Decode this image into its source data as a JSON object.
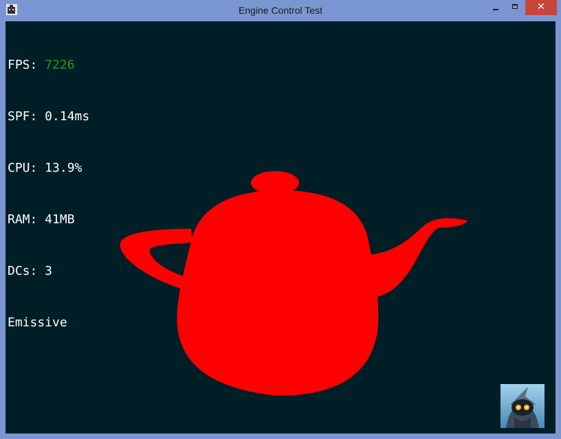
{
  "window": {
    "title": "Engine Control Test",
    "icon": "teapot-app-icon",
    "controls": {
      "minimize_icon": "minimize-icon",
      "maximize_icon": "maximize-icon",
      "close_icon": "close-icon",
      "close_glyph": "✕"
    }
  },
  "hud": {
    "fps_label": "FPS: ",
    "fps_value": "7226",
    "spf": "SPF: 0.14ms",
    "cpu": "CPU: 13.9%",
    "ram": "RAM: 41MB",
    "dcs": "DCs: 3",
    "mode": "Emissive"
  },
  "scene": {
    "object": "teapot",
    "object_color": "#ff0000",
    "background_color": "#001e26"
  },
  "colors": {
    "fps_value": "#1f9b1f",
    "hud_text": "#ffffff",
    "title_bar": "#7b97d3",
    "close_button": "#c7463a"
  },
  "thumbnail": {
    "icon": "wizard-avatar-icon"
  }
}
